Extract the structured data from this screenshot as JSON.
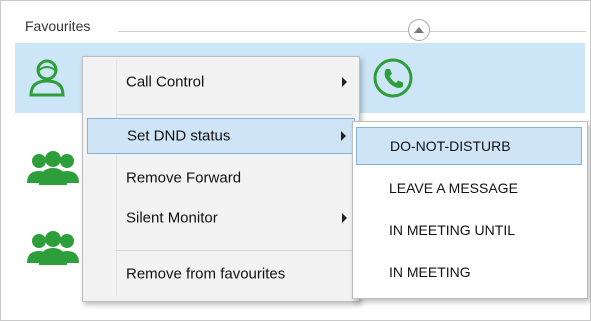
{
  "favourites": {
    "header": "Favourites"
  },
  "context_menu": {
    "items": [
      {
        "label": "Call Control",
        "has_submenu": true
      },
      {
        "label": "Set DND status",
        "has_submenu": true
      },
      {
        "label": "Remove Forward",
        "has_submenu": false
      },
      {
        "label": "Silent Monitor",
        "has_submenu": true
      },
      {
        "label": "Remove from favourites",
        "has_submenu": false
      }
    ]
  },
  "dnd_submenu": {
    "items": [
      {
        "label": "DO-NOT-DISTURB"
      },
      {
        "label": "LEAVE A MESSAGE"
      },
      {
        "label": "IN MEETING UNTIL"
      },
      {
        "label": "IN MEETING"
      }
    ]
  },
  "colors": {
    "accent_green": "#2e9e3a",
    "selection_blue": "#cde6f7"
  }
}
